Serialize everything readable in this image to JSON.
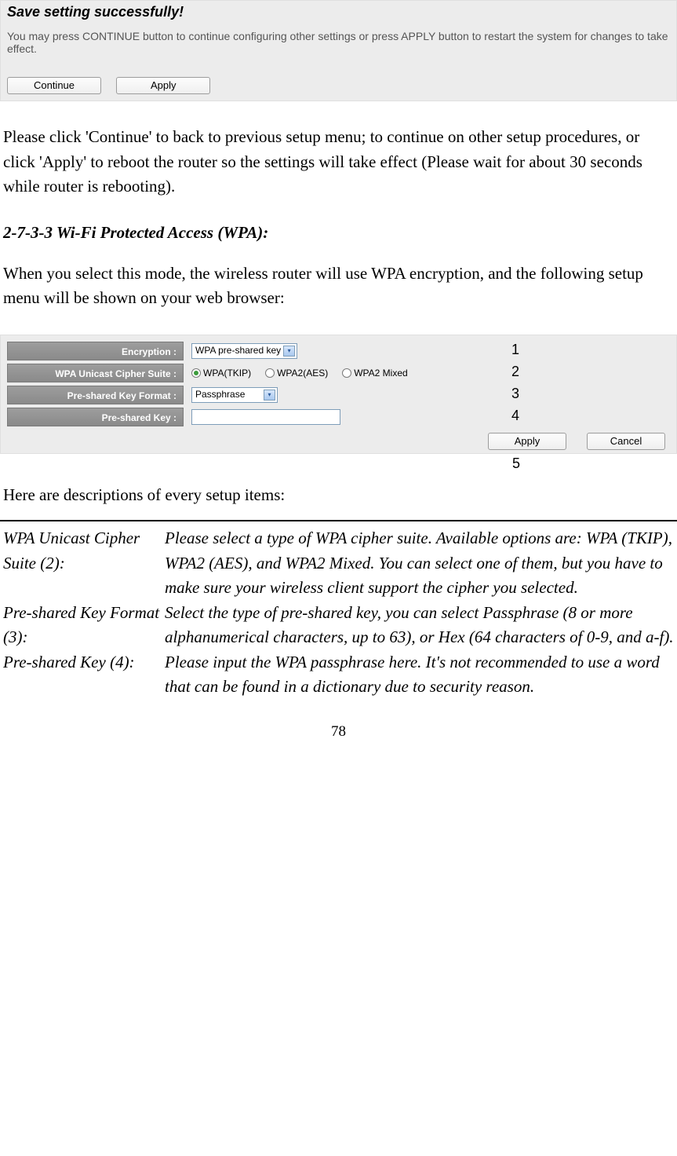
{
  "save_panel": {
    "title": "Save setting successfully!",
    "desc": "You may press CONTINUE button to continue configuring other settings or press APPLY button to restart the system for changes to take effect.",
    "continue": "Continue",
    "apply": "Apply"
  },
  "para1": "Please click 'Continue' to back to previous setup menu; to continue on other setup procedures, or click 'Apply' to reboot the router so the settings will take effect (Please wait for about 30 seconds while router is rebooting).",
  "heading": "2-7-3-3 Wi-Fi Protected Access (WPA):",
  "para2": "When you select this mode, the wireless router will use WPA encryption, and the following setup menu will be shown on your web browser:",
  "wpa_form": {
    "encryption": {
      "label": "Encryption :",
      "value": "WPA pre-shared key"
    },
    "cipher": {
      "label": "WPA Unicast Cipher Suite :",
      "options": [
        "WPA(TKIP)",
        "WPA2(AES)",
        "WPA2 Mixed"
      ],
      "selected": "WPA(TKIP)"
    },
    "format": {
      "label": "Pre-shared Key Format :",
      "value": "Passphrase"
    },
    "key": {
      "label": "Pre-shared Key :",
      "value": ""
    },
    "apply": "Apply",
    "cancel": "Cancel"
  },
  "callouts": {
    "c1": "1",
    "c2": "2",
    "c3": "3",
    "c4": "4",
    "c5": "5"
  },
  "para3": "Here are descriptions of every setup items:",
  "desc": {
    "r1_term": "WPA Unicast Cipher Suite (2):",
    "r1_def": "Please select a type of WPA cipher suite. Available options are: WPA (TKIP), WPA2 (AES), and WPA2 Mixed. You can select one of them, but you have to make sure your wireless client support the cipher you selected.",
    "r2_term": "Pre-shared Key Format (3):",
    "r2_def": "Select the type of pre-shared key, you can select Passphrase (8 or more alphanumerical characters, up to 63), or Hex (64 characters of 0-9, and a-f).",
    "r3_term": "Pre-shared Key (4):",
    "r3_def": "Please input the WPA passphrase here. It's not recommended to use a word that can be found in a dictionary due to security reason."
  },
  "page_number": "78"
}
